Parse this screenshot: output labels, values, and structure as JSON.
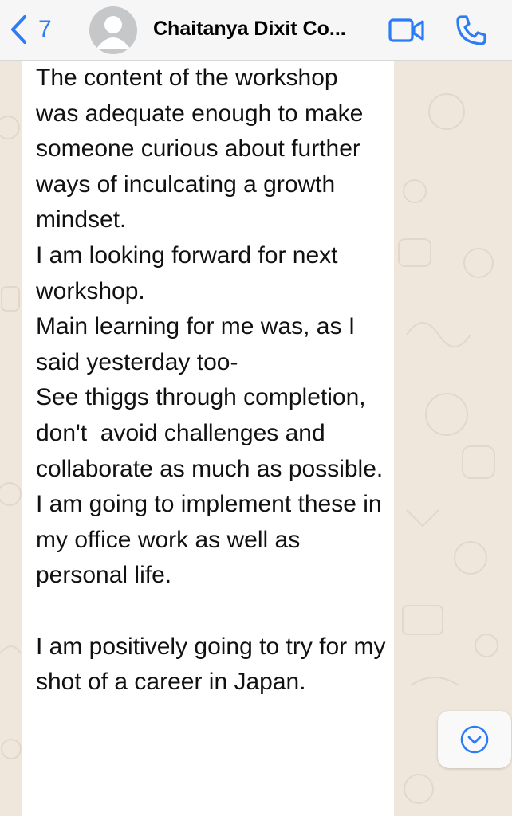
{
  "header": {
    "back_count": "7",
    "contact_name": "Chaitanya Dixit Co...",
    "back_icon": "chevron-left-icon",
    "video_icon": "video-camera-icon",
    "call_icon": "phone-icon"
  },
  "message": {
    "text": "The content of the workshop was adequate enough to make someone curious about further ways of inculcating a growth mindset.\nI am looking forward for next workshop.\nMain learning for me was, as I said yesterday too-\nSee thiggs through completion, don't  avoid challenges and collaborate as much as possible.\nI am going to implement these in my office work as well as personal life.\n\nI am positively going to try for my shot of a career in Japan."
  },
  "scroll_down": {
    "icon": "chevron-down-circle-icon"
  },
  "colors": {
    "accent": "#2b7cf6",
    "header_bg": "#f6f6f6",
    "wallpaper_bg": "#efe7dc",
    "bubble_bg": "#ffffff"
  }
}
